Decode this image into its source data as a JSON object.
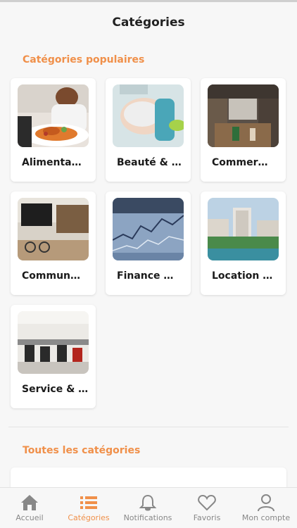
{
  "header": {
    "title": "Catégories"
  },
  "popular": {
    "title": "Catégories populaires",
    "items": [
      {
        "label": "Alimenta…",
        "image": "food-image"
      },
      {
        "label": "Beauté & …",
        "image": "beauty-image"
      },
      {
        "label": "Commer…",
        "image": "store-image"
      },
      {
        "label": "Commun…",
        "image": "community-image"
      },
      {
        "label": "Finance …",
        "image": "finance-image"
      },
      {
        "label": "Location …",
        "image": "resort-image"
      },
      {
        "label": "Service & …",
        "image": "gym-image"
      }
    ]
  },
  "all": {
    "title": "Toutes les catégories"
  },
  "tabbar": {
    "accent": "#f0904a",
    "items": [
      {
        "label": "Accueil",
        "icon": "home-icon"
      },
      {
        "label": "Catégories",
        "icon": "list-icon"
      },
      {
        "label": "Notifications",
        "icon": "bell-icon"
      },
      {
        "label": "Favoris",
        "icon": "heart-icon"
      },
      {
        "label": "Mon compte",
        "icon": "user-icon"
      }
    ]
  }
}
